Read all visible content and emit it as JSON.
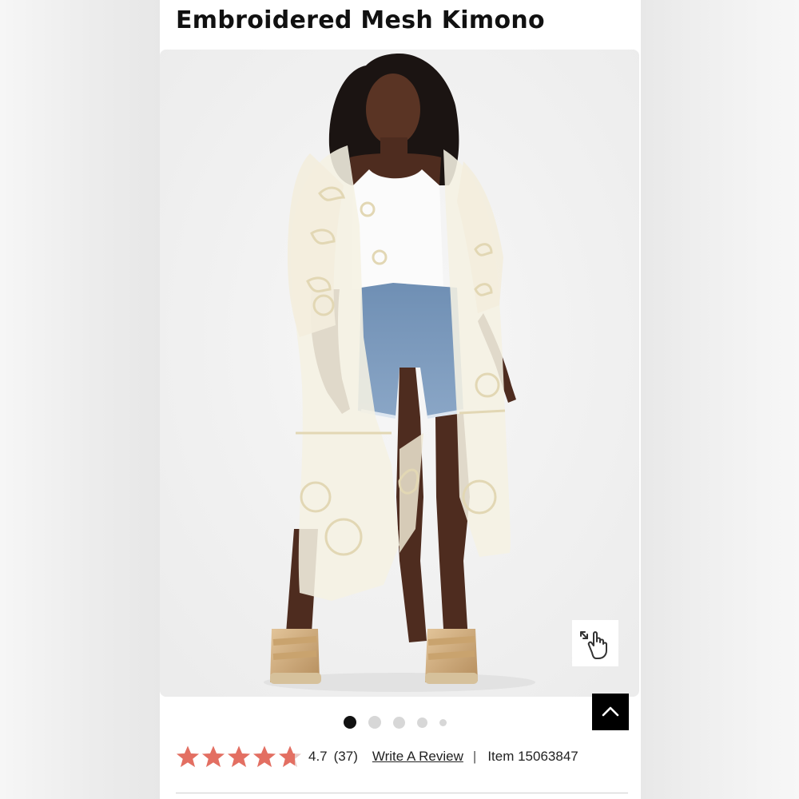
{
  "product": {
    "title": "Embroidered Mesh Kimono"
  },
  "gallery": {
    "image_count": 5,
    "active_index": 0,
    "zoom_icon": "tap-to-zoom-hand-icon"
  },
  "rating": {
    "stars": 4.7,
    "score": "4.7",
    "count": "(37)",
    "star_color": "#e36f62"
  },
  "links": {
    "write_review": "Write A Review",
    "separator": "|",
    "item_number": "Item 15063847"
  },
  "icons": {
    "back_to_top": "chevron-up-icon"
  }
}
